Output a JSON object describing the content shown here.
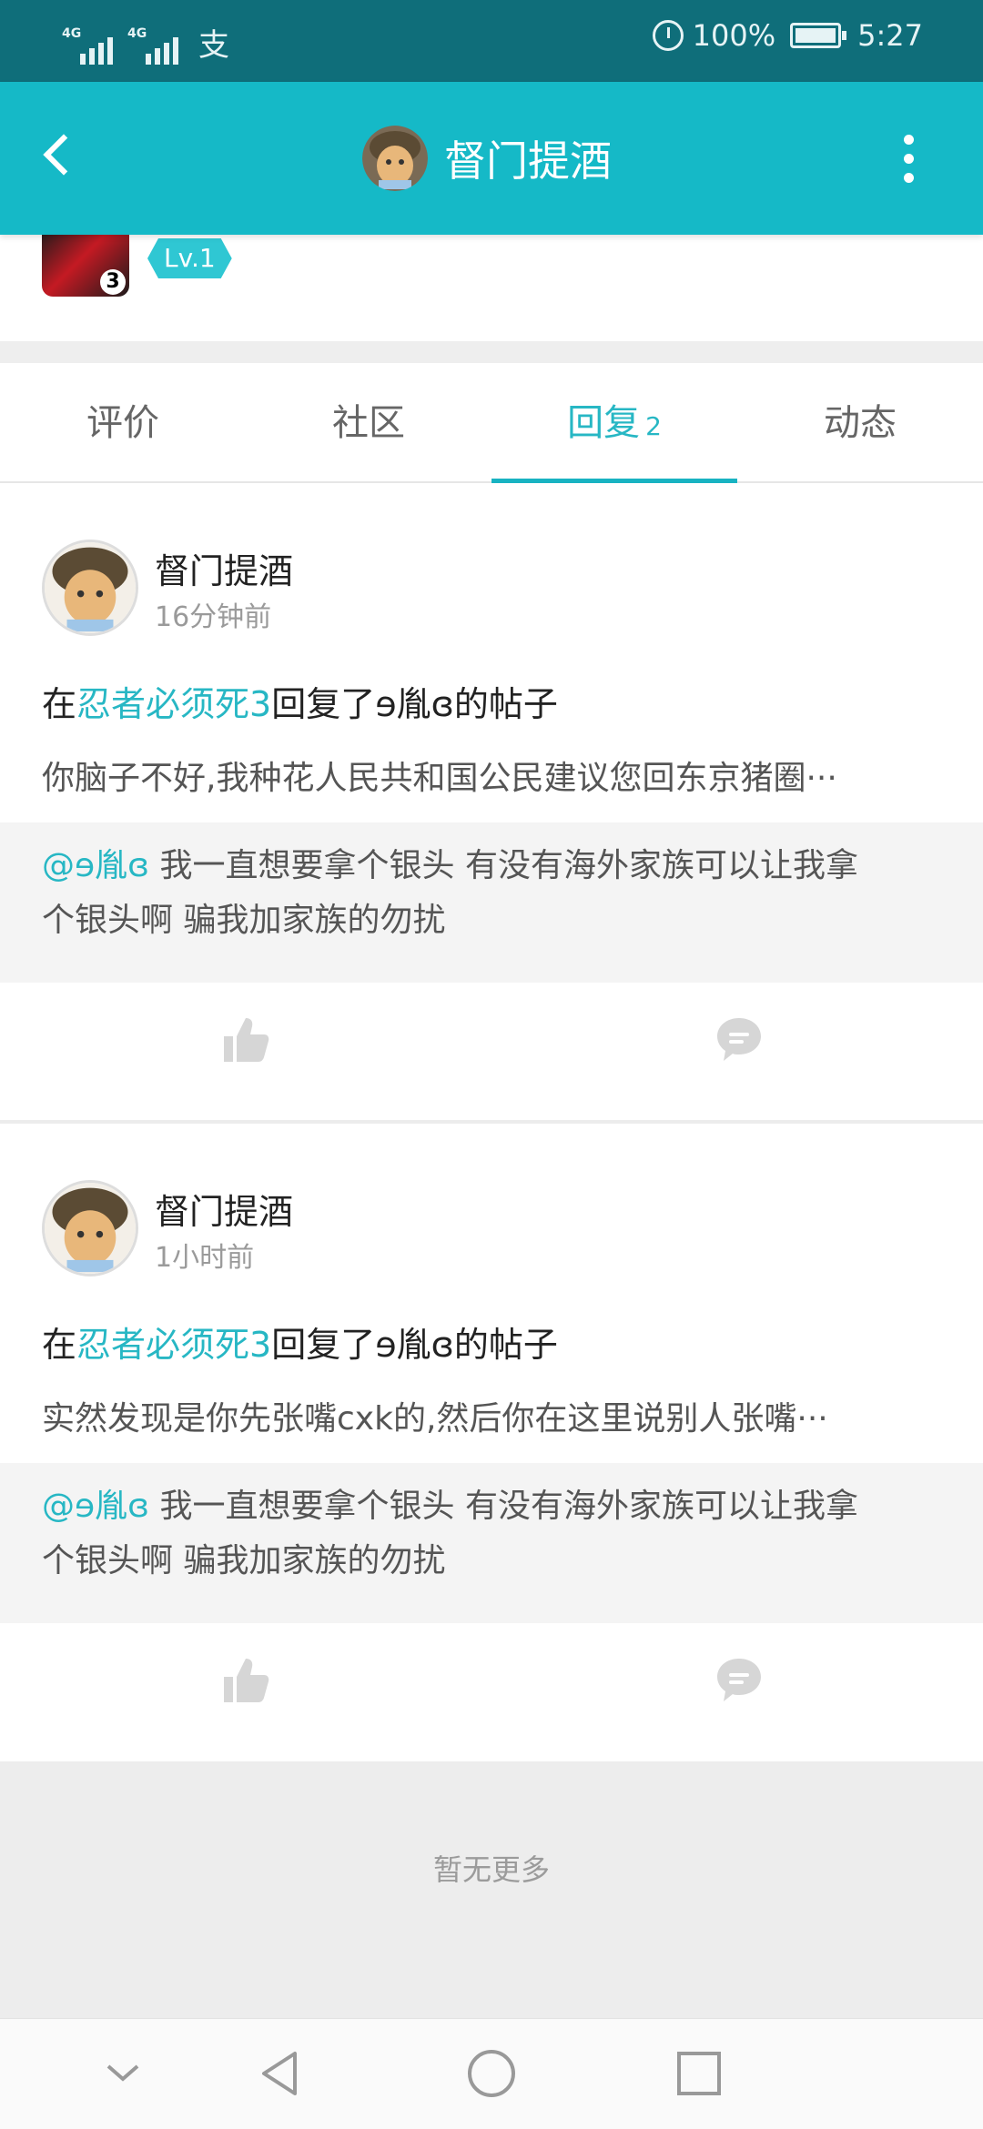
{
  "status_bar": {
    "network_1": "4G",
    "network_2": "4G",
    "pay_icon": "支",
    "battery": "100%",
    "time": "5:27"
  },
  "app_bar": {
    "title": "督门提酒",
    "back_icon": "chevron-left-icon",
    "menu_icon": "more-vertical-icon"
  },
  "profile": {
    "level_badge": "Lv.1",
    "game_icon_number": "3"
  },
  "tabs": [
    {
      "label": "评价",
      "count": ""
    },
    {
      "label": "社区",
      "count": ""
    },
    {
      "label": "回复",
      "count": "2"
    },
    {
      "label": "动态",
      "count": ""
    }
  ],
  "posts": [
    {
      "username": "督门提酒",
      "time": "16分钟前",
      "title_prefix": "在",
      "game": "忍者必须死3",
      "title_suffix": "回复了ɘ胤ɞ的帖子",
      "body": "你脑子不好,我种花人民共和国公民建议您回东京猪圈···",
      "quote_mention": "@ɘ胤ɞ",
      "quote_line1": "我一直想要拿个银头 有没有海外家族可以让我拿",
      "quote_line2": "个银头啊 骗我加家族的勿扰"
    },
    {
      "username": "督门提酒",
      "time": "1小时前",
      "title_prefix": "在",
      "game": "忍者必须死3",
      "title_suffix": "回复了ɘ胤ɞ的帖子",
      "body": "实然发现是你先张嘴cxk的,然后你在这里说别人张嘴···",
      "quote_mention": "@ɘ胤ɞ",
      "quote_line1": "我一直想要拿个银头 有没有海外家族可以让我拿",
      "quote_line2": "个银头啊 骗我加家族的勿扰"
    }
  ],
  "footer": {
    "no_more": "暂无更多"
  },
  "colors": {
    "status_bar": "#0f6e7a",
    "accent": "#15b9c7",
    "accent_text": "#27b7c4"
  }
}
